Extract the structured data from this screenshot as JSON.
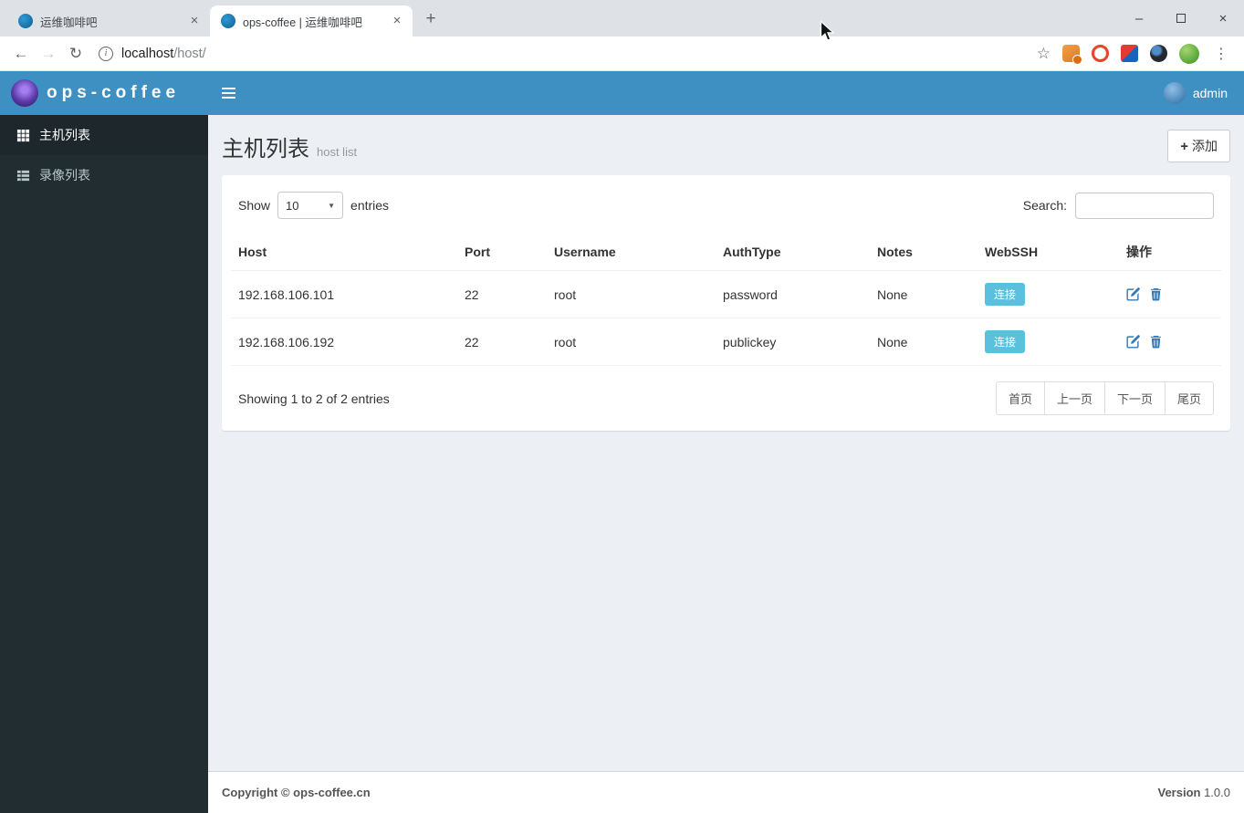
{
  "colors": {
    "header_blue": "#3f90c2",
    "sidebar_dark": "#222d32",
    "sidebar_active": "#1e282c",
    "content_bg": "#ecf0f5",
    "connect_button": "#5bc0de",
    "action_icon_blue": "#337ab7"
  },
  "icons": {
    "back": "←",
    "forward": "→",
    "reload": "↻",
    "info": "i",
    "star": "☆",
    "menu_dots": "⋮",
    "new_tab_plus": "+",
    "tab_close": "×",
    "win_minimize": "–",
    "win_close": "×",
    "caret_down": "▼",
    "add_plus": "+"
  },
  "browser": {
    "tabs": [
      {
        "title": "运维咖啡吧"
      },
      {
        "title": "ops-coffee | 运维咖啡吧"
      }
    ],
    "url_host": "localhost",
    "url_path": "/host/"
  },
  "app_header": {
    "brand": "ops-coffee",
    "user": "admin"
  },
  "sidebar": {
    "items": [
      {
        "label": "主机列表"
      },
      {
        "label": "录像列表"
      }
    ]
  },
  "content": {
    "title": "主机列表",
    "subtitle": "host list",
    "add_button": "添加"
  },
  "datatable": {
    "show_label": "Show",
    "length_value": "10",
    "entries_label": "entries",
    "search_label": "Search:",
    "columns": [
      "Host",
      "Port",
      "Username",
      "AuthType",
      "Notes",
      "WebSSH",
      "操作"
    ],
    "rows": [
      {
        "host": "192.168.106.101",
        "port": "22",
        "username": "root",
        "authtype": "password",
        "notes": "None",
        "connect": "连接"
      },
      {
        "host": "192.168.106.192",
        "port": "22",
        "username": "root",
        "authtype": "publickey",
        "notes": "None",
        "connect": "连接"
      }
    ],
    "info": "Showing 1 to 2 of 2 entries",
    "pagination": [
      "首页",
      "上一页",
      "下一页",
      "尾页"
    ]
  },
  "footer": {
    "copyright": "Copyright © ops-coffee.cn",
    "version_label": "Version",
    "version_value": "1.0.0"
  }
}
